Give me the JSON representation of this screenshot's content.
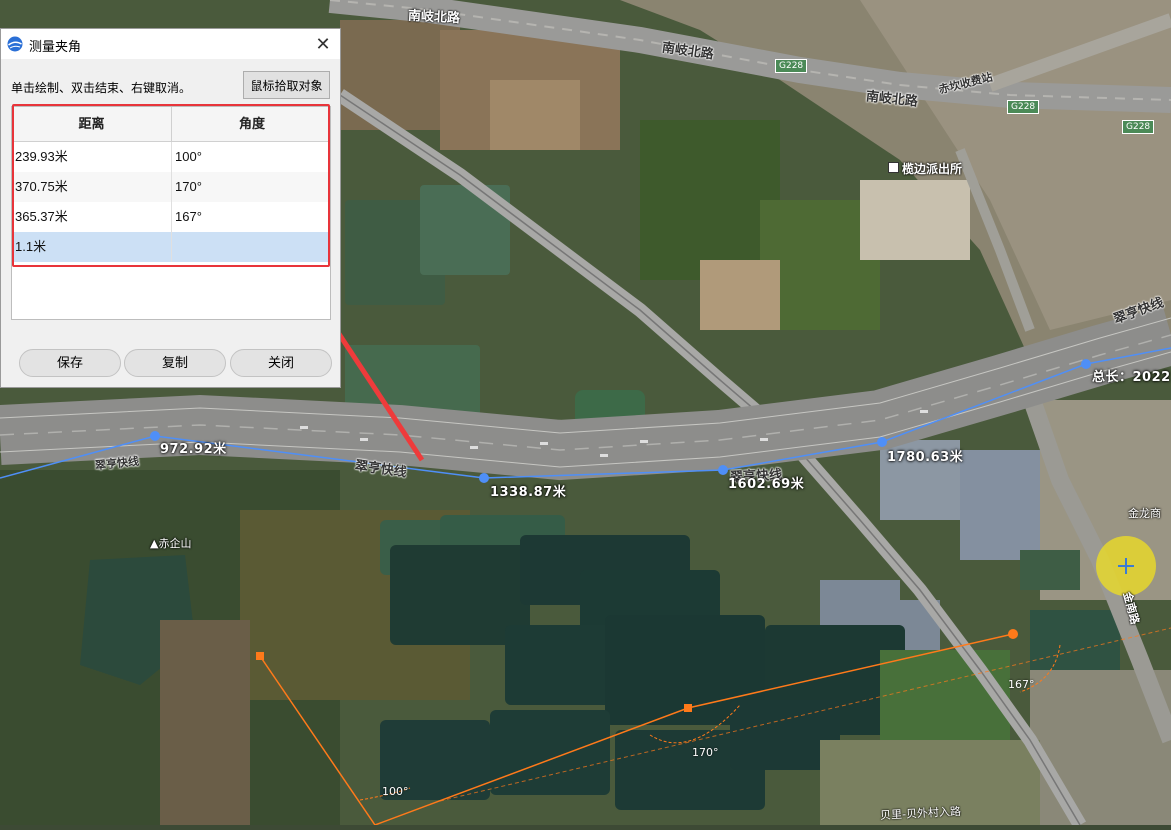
{
  "map": {
    "roads": {
      "nanqi_1": "南岐北路",
      "nanqi_2": "南岐北路",
      "nanqi_3": "南岐北路",
      "chikan": "赤坎收费站",
      "cuiheng_left": "翠亨快线",
      "cuiheng_mid": "翠亨快线",
      "cuiheng_mid2": "翠亨快线",
      "cuiheng_right": "翠亨快线",
      "g228_1": "G228",
      "g228_2": "G228",
      "g228_3": "G228",
      "jiaxiang": "金龙商",
      "right_vert": "金南路",
      "beili": "贝里-贝外村入路"
    },
    "pois": {
      "police": "榄边派出所",
      "chiqi_mountain": "赤企山"
    },
    "measurements": {
      "m1": "972.92米",
      "m2": "1338.87米",
      "m3": "1602.69米",
      "m4": "1780.63米",
      "total": "总长：2022"
    },
    "angles": {
      "a100": "100°",
      "a170": "170°",
      "a167": "167°"
    }
  },
  "dialog": {
    "title": "测量夹角",
    "hint": "单击绘制、双击结束、右键取消。",
    "pick_button": "鼠标拾取对象",
    "columns": [
      "距离",
      "角度"
    ],
    "rows": [
      {
        "distance": "239.93米",
        "angle": "100°"
      },
      {
        "distance": "370.75米",
        "angle": "170°"
      },
      {
        "distance": "365.37米",
        "angle": "167°"
      },
      {
        "distance": "1.1米",
        "angle": ""
      }
    ],
    "buttons": {
      "save": "保存",
      "copy": "复制",
      "close": "关闭"
    }
  },
  "colors": {
    "measure_line": "#4f8ff7",
    "angle_line": "#ff7a1a",
    "highlight_red": "#e8343a",
    "selected_row": "#cce0f5"
  }
}
